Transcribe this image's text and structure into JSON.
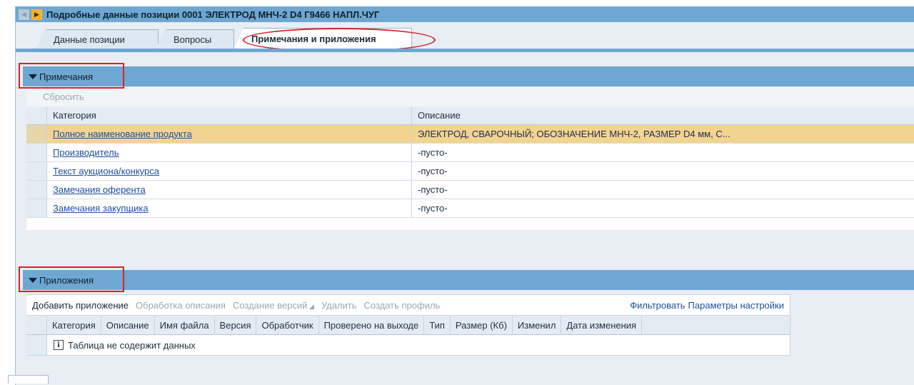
{
  "header": {
    "title": "Подробные данные позиции 0001 ЭЛЕКТРОД МНЧ-2 D4 Г9466 НАПЛ.ЧУГ",
    "prev_icon": "triangle-left-icon",
    "next_icon": "triangle-right-icon",
    "accent_color": "#6ea7d2",
    "next_color": "#f6b233"
  },
  "tabs": [
    {
      "label": "Данные позиции",
      "selected": false
    },
    {
      "label": "Вопросы",
      "selected": false
    },
    {
      "label": "Примечания и приложения",
      "selected": true
    }
  ],
  "notes": {
    "section_label": "Примечания",
    "reset_label": "Сбросить",
    "columns": [
      "Категория",
      "Описание"
    ],
    "rows": [
      {
        "category": "Полное наименование продукта",
        "description": "ЭЛЕКТРОД, СВАРОЧНЫЙ; ОБОЗНАЧЕНИЕ МНЧ-2, РАЗМЕР D4 мм, С...",
        "selected": true
      },
      {
        "category": "Производитель",
        "description": "-пусто-",
        "selected": false
      },
      {
        "category": "Текст аукциона/конкурса",
        "description": "-пусто-",
        "selected": false
      },
      {
        "category": "Замечания оферента",
        "description": "-пусто-",
        "selected": false
      },
      {
        "category": "Замечания закупщика",
        "description": "-пусто-",
        "selected": false
      }
    ],
    "selected_row_color": "#f2d491"
  },
  "attachments": {
    "section_label": "Приложения",
    "toolbar": {
      "add": "Добавить приложение",
      "edit_description": "Обработка описания",
      "versioning": "Создание версий",
      "delete": "Удалить",
      "create_profile": "Создать профиль",
      "filter": "Фильтровать",
      "settings": "Параметры настройки"
    },
    "columns": [
      "Категория",
      "Описание",
      "Имя файла",
      "Версия",
      "Обработчик",
      "Проверено на выходе",
      "Тип",
      "Размер (Кб)",
      "Изменил",
      "Дата изменения"
    ],
    "empty_text": "Таблица не содержит данных",
    "info_icon": "info-icon"
  },
  "highlight_color": "#e31e26"
}
